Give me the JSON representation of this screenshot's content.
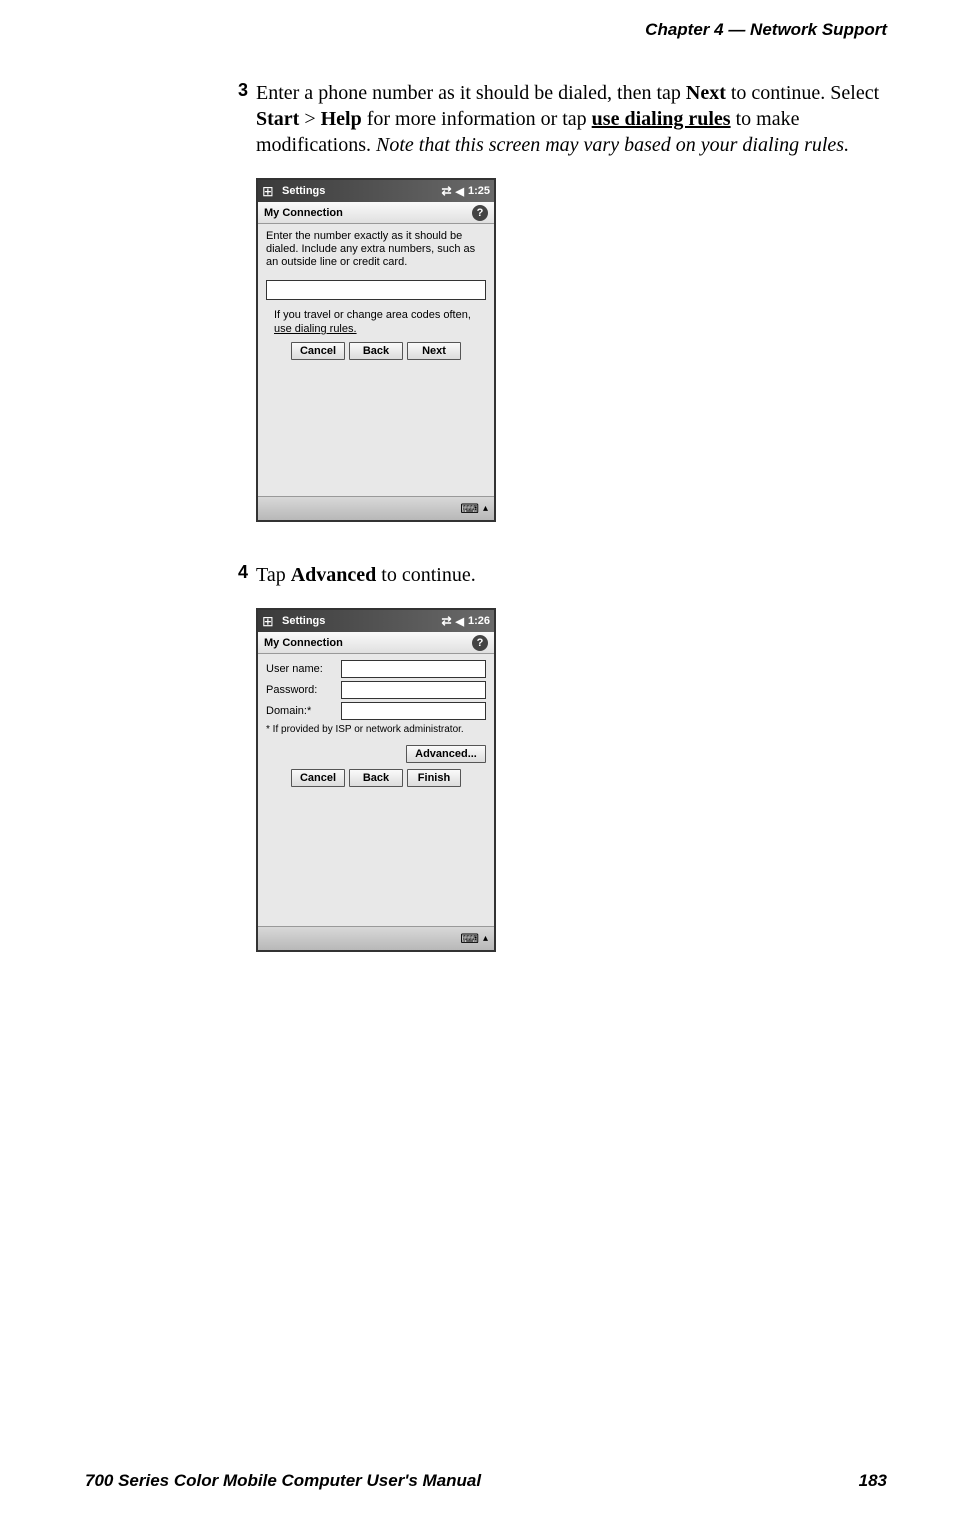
{
  "header": {
    "chapter": "Chapter  4",
    "sep": "  —  ",
    "title": "Network Support"
  },
  "footer": {
    "manual": "700 Series Color Mobile Computer User's Manual",
    "page": "183"
  },
  "step3": {
    "num": "3",
    "t1": "Enter a phone number as it should be dialed, then tap ",
    "b1": "Next",
    "t2": " to continue. Select ",
    "b2": "Start",
    "t3": " > ",
    "b3": "Help",
    "t4": " for more information or tap ",
    "b4": "use dialing rules",
    "t5": " to make modifications. ",
    "i1": "Note that this screen may vary based on your dialing rules."
  },
  "step4": {
    "num": "4",
    "t1": "Tap ",
    "b1": "Advanced",
    "t2": " to continue."
  },
  "ss1": {
    "title": "Settings",
    "time": "1:25",
    "sub": "My Connection",
    "instruct": "Enter the number exactly as it should be dialed.  Include any extra numbers, such as an outside line or credit card.",
    "hint1": "If you travel or change area codes often,",
    "hintlink": "use dialing rules.",
    "cancel": "Cancel",
    "back": "Back",
    "next": "Next"
  },
  "ss2": {
    "title": "Settings",
    "time": "1:26",
    "sub": "My Connection",
    "user": "User name:",
    "pass": "Password:",
    "domain": "Domain:*",
    "note": "* If provided by ISP or network administrator.",
    "adv": "Advanced...",
    "cancel": "Cancel",
    "back": "Back",
    "finish": "Finish"
  }
}
